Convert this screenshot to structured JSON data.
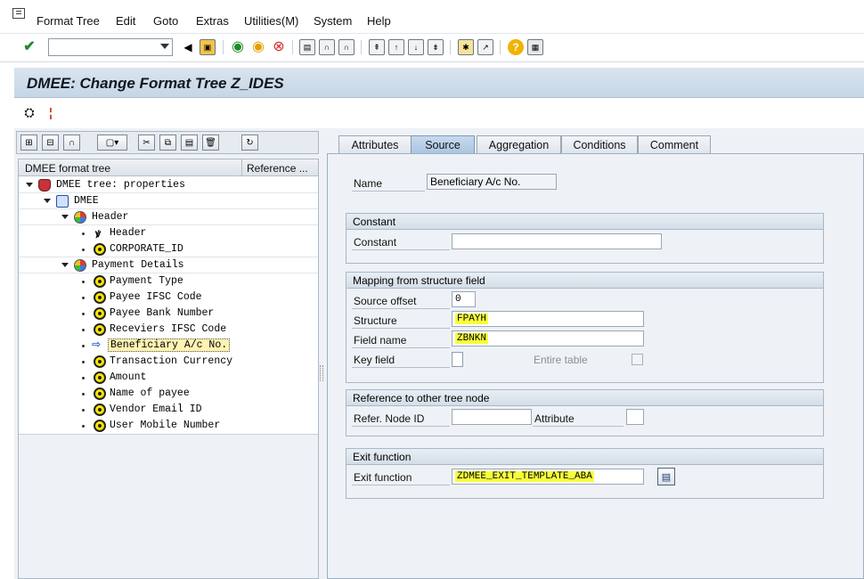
{
  "menu": {
    "items": [
      {
        "label": "Format Tree"
      },
      {
        "label": "Edit"
      },
      {
        "label": "Goto"
      },
      {
        "label": "Extras"
      },
      {
        "label": "Utilities(M)"
      },
      {
        "label": "System"
      },
      {
        "label": "Help"
      }
    ]
  },
  "toolbar": {
    "command_value": ""
  },
  "title": "DMEE: Change Format Tree Z_IDES",
  "tabs": [
    {
      "label": "Attributes"
    },
    {
      "label": "Source"
    },
    {
      "label": "Aggregation"
    },
    {
      "label": "Conditions"
    },
    {
      "label": "Comment"
    }
  ],
  "tree": {
    "col1": "DMEE format tree",
    "col2": "Reference ...",
    "rows": [
      {
        "label": "DMEE tree: properties"
      },
      {
        "label": "DMEE"
      },
      {
        "label": "Header"
      },
      {
        "label": "Header"
      },
      {
        "label": "CORPORATE_ID"
      },
      {
        "label": "Payment Details"
      },
      {
        "label": "Payment Type"
      },
      {
        "label": "Payee IFSC Code"
      },
      {
        "label": "Payee Bank Number"
      },
      {
        "label": "Receviers IFSC Code"
      },
      {
        "label": "Beneficiary A/c No."
      },
      {
        "label": "Transaction Currency"
      },
      {
        "label": "Amount"
      },
      {
        "label": "Name of payee"
      },
      {
        "label": "Vendor Email ID"
      },
      {
        "label": "User Mobile Number"
      }
    ]
  },
  "form": {
    "name_label": "Name",
    "name_value": "Beneficiary A/c No.",
    "constant_group": "Constant",
    "constant_label": "Constant",
    "constant_value": "",
    "mapping_group": "Mapping from structure field",
    "source_offset_label": "Source offset",
    "source_offset_value": "0",
    "structure_label": "Structure",
    "structure_value": "FPAYH",
    "fieldname_label": "Field name",
    "fieldname_value": "ZBNKN",
    "keyfield_label": "Key field",
    "entire_table_label": "Entire table",
    "reference_group": "Reference to other tree node",
    "refer_node_label": "Refer. Node ID",
    "refer_node_value": "",
    "attribute_label": "Attribute",
    "attribute_value": "",
    "exit_group": "Exit function",
    "exit_label": "Exit function",
    "exit_value": "ZDMEE_EXIT_TEMPLATE_ABA"
  },
  "colors": {
    "highlight": "#f7ff3c",
    "title_bg": "#c6d6e6",
    "active_tab": "#a9c4e2"
  }
}
